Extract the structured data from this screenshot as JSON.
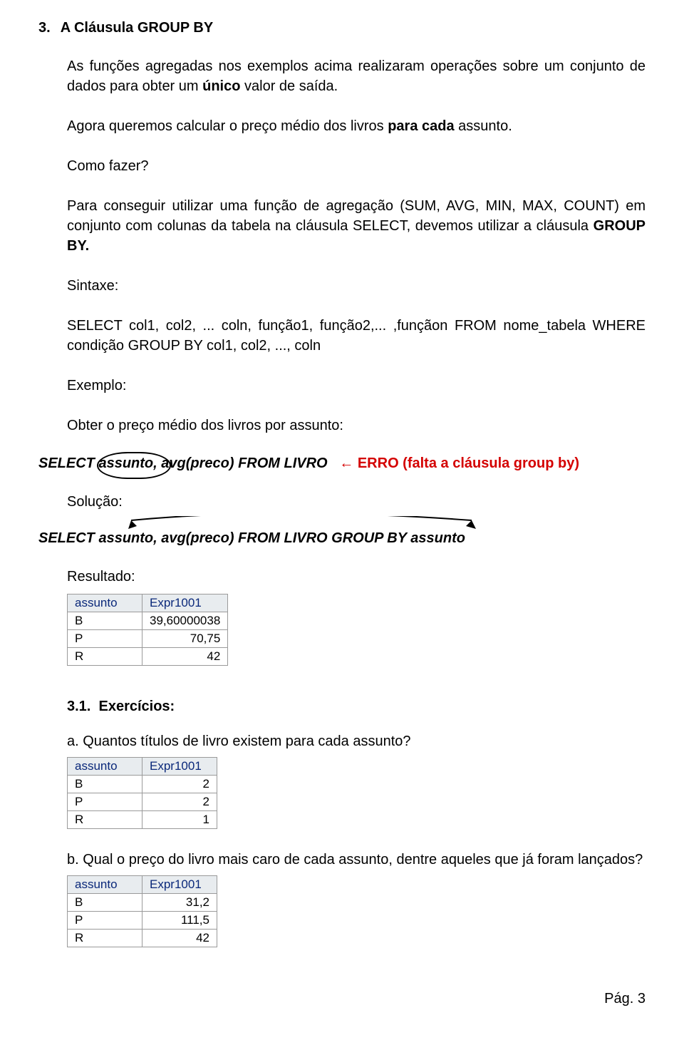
{
  "section": {
    "number": "3.",
    "title": "A Cláusula GROUP BY"
  },
  "p1_a": "As funções agregadas nos exemplos acima realizaram operações sobre um conjunto de dados para obter um ",
  "p1_b": "único",
  "p1_c": " valor de saída.",
  "p2_a": "Agora queremos calcular o preço médio dos livros ",
  "p2_b": "para cada",
  "p2_c": " assunto.",
  "p3": "Como fazer?",
  "p4_a": "Para conseguir utilizar uma função de agregação (SUM, AVG, MIN, MAX, COUNT) em conjunto com colunas da tabela na cláusula SELECT, devemos utilizar a cláusula ",
  "p4_b": "GROUP BY.",
  "sintaxe_label": "Sintaxe:",
  "sintaxe_text": "SELECT col1, col2, ... coln, função1, função2,... ,funçãon   FROM   nome_tabela WHERE  condição   GROUP BY col1, col2, ..., coln",
  "exemplo_label": "Exemplo:",
  "exemplo_desc": "Obter o preço médio dos livros por assunto:",
  "sql_error": {
    "select_kw": "SELECT ",
    "assunto": "assunto,",
    "rest": " avg(preco) FROM LIVRO",
    "arrow": "←",
    "err": "ERRO (falta a cláusula group by)"
  },
  "solucao_label": "Solução:",
  "sql_ok": "SELECT assunto, avg(preco) FROM LIVRO GROUP BY assunto",
  "resultado_label": "Resultado:",
  "table1": {
    "headers": [
      "assunto",
      "Expr1001"
    ],
    "rows": [
      [
        "B",
        "39,60000038"
      ],
      [
        "P",
        "70,75"
      ],
      [
        "R",
        "42"
      ]
    ]
  },
  "exercicios": {
    "number": "3.1.",
    "title": "Exercícios:"
  },
  "ex_a": "a.  Quantos títulos de livro existem para cada assunto?",
  "table2": {
    "headers": [
      "assunto",
      "Expr1001"
    ],
    "rows": [
      [
        "B",
        "2"
      ],
      [
        "P",
        "2"
      ],
      [
        "R",
        "1"
      ]
    ]
  },
  "ex_b": "b.  Qual o preço do livro mais caro de cada assunto, dentre aqueles que já foram lançados?",
  "table3": {
    "headers": [
      "assunto",
      "Expr1001"
    ],
    "rows": [
      [
        "B",
        "31,2"
      ],
      [
        "P",
        "111,5"
      ],
      [
        "R",
        "42"
      ]
    ]
  },
  "footer": "Pág. 3"
}
